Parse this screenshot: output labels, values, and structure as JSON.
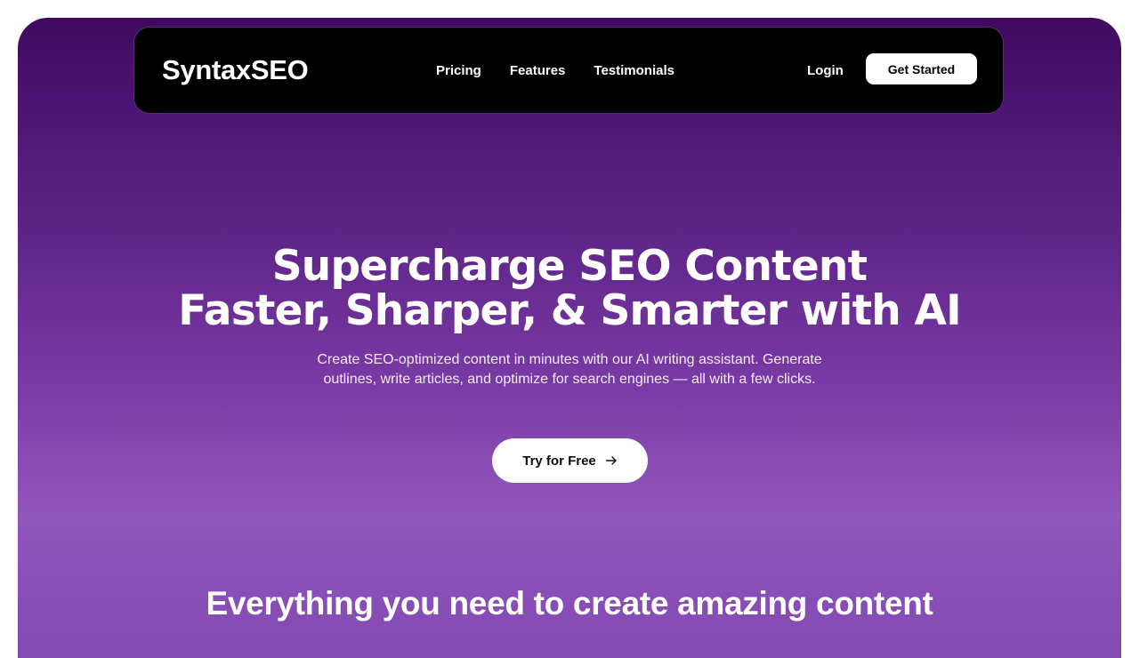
{
  "brand": "SyntaxSEO",
  "nav": {
    "links": [
      "Pricing",
      "Features",
      "Testimonials"
    ],
    "login": "Login",
    "cta": "Get Started"
  },
  "hero": {
    "title_line1": "Supercharge SEO Content",
    "title_line2": "Faster, Sharper, & Smarter with AI",
    "subtitle": "Create SEO-optimized content in minutes with our AI writing assistant. Generate outlines, write articles, and optimize for search engines — all with a few clicks.",
    "cta": "Try for Free",
    "cta_icon": "arrow-right-icon"
  },
  "features": {
    "title": "Everything you need to create amazing content"
  },
  "colors": {
    "background_top": "#3f0a5e",
    "background_mid": "#9257bd",
    "navbar": "#000000",
    "button": "#ffffff"
  }
}
